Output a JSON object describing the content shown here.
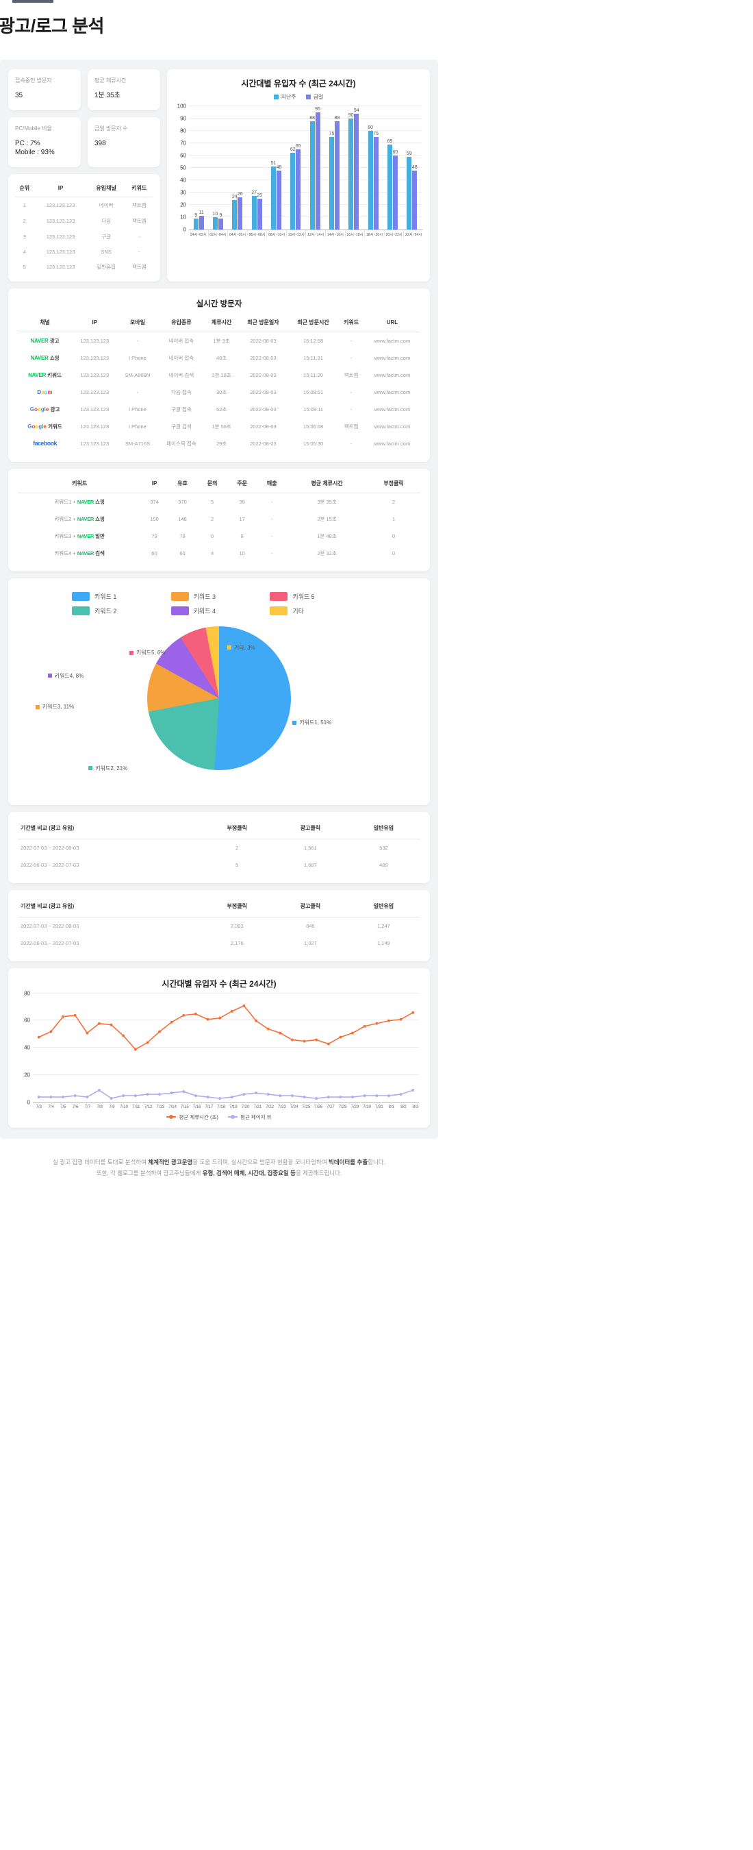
{
  "page": {
    "title": "광고/로그 분석"
  },
  "stats": [
    {
      "label": "접속중인 방문자",
      "value": "35"
    },
    {
      "label": "평균 체류시간",
      "value": "1분 35초"
    },
    {
      "label": "PC/Mobile 비율",
      "value": "PC : 7%\nMobile : 93%"
    },
    {
      "label": "금일 방문자 수",
      "value": "398"
    }
  ],
  "rank_table": {
    "headers": [
      "순위",
      "IP",
      "유입채널",
      "키워드"
    ],
    "rows": [
      [
        "1",
        "123.123.123",
        "네이버",
        "팩트엠"
      ],
      [
        "2",
        "123.123.123",
        "다음",
        "팩트엠"
      ],
      [
        "3",
        "123.123.123",
        "구글",
        "-"
      ],
      [
        "4",
        "123.123.123",
        "SNS",
        "-"
      ],
      [
        "5",
        "123.123.123",
        "일반유입",
        "팩트엠"
      ]
    ]
  },
  "chart_data": [
    {
      "type": "bar",
      "title": "시간대별 유입자 수 (최근 24시간)",
      "legend": [
        "지난주",
        "금일"
      ],
      "colors": [
        "#44aee0",
        "#7b7fe8"
      ],
      "categories": [
        "24시~02시",
        "02시~04시",
        "04시~05시",
        "06시~08시",
        "08시~10시",
        "10시~12시",
        "12시~14시",
        "14시~16시",
        "16시~18시",
        "18시~20시",
        "20시~22시",
        "22시~24시"
      ],
      "series": [
        {
          "name": "지난주",
          "values": [
            9,
            10,
            24,
            27,
            51,
            62,
            88,
            75,
            90,
            80,
            69,
            59
          ]
        },
        {
          "name": "금일",
          "values": [
            11,
            9,
            26,
            25,
            48,
            65,
            95,
            88,
            94,
            75,
            60,
            48
          ]
        }
      ],
      "ylim": [
        0,
        100
      ],
      "yticks": [
        0,
        10,
        20,
        30,
        40,
        50,
        60,
        70,
        80,
        90,
        100
      ],
      "xlabel": "",
      "ylabel": "",
      "grid": true,
      "legend_position": "top"
    },
    {
      "type": "pie",
      "title": "",
      "labels": [
        "키워드 1",
        "키워드 2",
        "키워드 3",
        "키워드 4",
        "키워드 5",
        "기타"
      ],
      "values": [
        51,
        21,
        11,
        8,
        6,
        3
      ],
      "colors": [
        "#3fa9f5",
        "#4cc0ae",
        "#f5a23c",
        "#9b63e8",
        "#f4607c",
        "#fcc63f"
      ],
      "annotations": [
        "키워드1, 51%",
        "키워드2, 21%",
        "키워드3, 11%",
        "키워드4, 8%",
        "키워드5, 6%",
        "기타, 3%"
      ],
      "legend_position": "top"
    },
    {
      "type": "line",
      "title": "시간대별 유입자 수 (최근 24시간)",
      "x": [
        "7/3",
        "7/4",
        "7/5",
        "7/6",
        "7/7",
        "7/8",
        "7/9",
        "7/10",
        "7/11",
        "7/12",
        "7/13",
        "7/14",
        "7/15",
        "7/16",
        "7/17",
        "7/18",
        "7/19",
        "7/20",
        "7/21",
        "7/22",
        "7/23",
        "7/24",
        "7/25",
        "7/26",
        "7/27",
        "7/28",
        "7/29",
        "7/30",
        "7/31",
        "8/1",
        "8/2",
        "8/3"
      ],
      "series": [
        {
          "name": "평균 체류시간 (초)",
          "color": "#f4703a",
          "values": [
            48,
            52,
            63,
            64,
            51,
            58,
            57,
            49,
            39,
            44,
            52,
            59,
            64,
            65,
            61,
            62,
            67,
            71,
            60,
            54,
            51,
            46,
            45,
            46,
            43,
            48,
            51,
            56,
            58,
            60,
            61,
            66
          ]
        },
        {
          "name": "평균 페이지 뷰",
          "color": "#aeadee",
          "values": [
            4,
            4,
            4,
            5,
            4,
            9,
            3,
            5,
            5,
            6,
            6,
            7,
            8,
            5,
            4,
            3,
            4,
            6,
            7,
            6,
            5,
            5,
            4,
            3,
            4,
            4,
            4,
            5,
            5,
            5,
            6,
            9
          ]
        }
      ],
      "ylim": [
        0,
        80
      ],
      "yticks": [
        0,
        20,
        40,
        60,
        80
      ],
      "grid": true,
      "legend_position": "bottom"
    }
  ],
  "realtime": {
    "title": "실시간 방문자",
    "headers": [
      "채널",
      "IP",
      "모바일",
      "유입종류",
      "체류시간",
      "최근 방문일자",
      "최근 방문시간",
      "키워드",
      "URL"
    ],
    "rows": [
      {
        "brand": "naver",
        "suffix": "광고",
        "ip": "123.123.123",
        "mobile": "-",
        "type": "네이버 접속",
        "stay": "1분 3초",
        "date": "2022-08-03",
        "time": "15:12:58",
        "keyword": "-",
        "url": "www.factm.com"
      },
      {
        "brand": "naver",
        "suffix": "쇼핑",
        "ip": "123.123.123",
        "mobile": "I Phone",
        "type": "네이버 접속",
        "stay": "48초",
        "date": "2022-08-03",
        "time": "15:11:31",
        "keyword": "-",
        "url": "www.factm.com"
      },
      {
        "brand": "naver",
        "suffix": "키워드",
        "ip": "123.123.123",
        "mobile": "SM-A908N",
        "type": "네이버 검색",
        "stay": "2분 18초",
        "date": "2022-08-03",
        "time": "15:11:20",
        "keyword": "팩트엠",
        "url": "www.factm.com"
      },
      {
        "brand": "daum",
        "suffix": "",
        "ip": "123.123.123",
        "mobile": "-",
        "type": "다음 접속",
        "stay": "30초",
        "date": "2022-08-03",
        "time": "15:08:51",
        "keyword": "-",
        "url": "www.factm.com"
      },
      {
        "brand": "google",
        "suffix": "광고",
        "ip": "123.123.123",
        "mobile": "I Phone",
        "type": "구글 접속",
        "stay": "52초",
        "date": "2022-08-03",
        "time": "15:08:11",
        "keyword": "-",
        "url": "www.factm.com"
      },
      {
        "brand": "google",
        "suffix": "키워드",
        "ip": "123.123.123",
        "mobile": "I Phone",
        "type": "구글 검색",
        "stay": "1분 56초",
        "date": "2022-08-03",
        "time": "15:06:08",
        "keyword": "팩트엠",
        "url": "www.factm.com"
      },
      {
        "brand": "facebook",
        "suffix": "",
        "ip": "123.123.123",
        "mobile": "SM-A716S",
        "type": "페이스북 접속",
        "stay": "29초",
        "date": "2022-08-03",
        "time": "15:05:30",
        "keyword": "-",
        "url": "www.factm.com"
      }
    ]
  },
  "keyword_table": {
    "headers": [
      "키워드",
      "IP",
      "유효",
      "문의",
      "주문",
      "매출",
      "평균 체류시간",
      "부정클릭"
    ],
    "rows": [
      {
        "pre": "키워드1 +",
        "brand": "NAVER",
        "post": "쇼핑",
        "ip": "374",
        "valid": "370",
        "inquiry": "5",
        "order": "35",
        "sales": "-",
        "stay": "3분 35초",
        "fraud": "2"
      },
      {
        "pre": "키워드2 +",
        "brand": "NAVER",
        "post": "쇼핑",
        "ip": "150",
        "valid": "148",
        "inquiry": "2",
        "order": "17",
        "sales": "-",
        "stay": "2분 15초",
        "fraud": "1"
      },
      {
        "pre": "키워드3 +",
        "brand": "NAVER",
        "post": "일반",
        "ip": "79",
        "valid": "78",
        "inquiry": "0",
        "order": "8",
        "sales": "-",
        "stay": "1분 48초",
        "fraud": "0"
      },
      {
        "pre": "키워드4 +",
        "brand": "NAVER",
        "post": "검색",
        "ip": "60",
        "valid": "60",
        "inquiry": "4",
        "order": "10",
        "sales": "-",
        "stay": "2분 32초",
        "fraud": "0"
      }
    ]
  },
  "compare_1": {
    "headers": [
      "기간별 비교 (광고 유입)",
      "부정클릭",
      "광고클릭",
      "일반유입"
    ],
    "rows": [
      [
        "2022-07-03 ~ 2022-08-03",
        "2",
        "1,561",
        "532"
      ],
      [
        "2022-06-03 ~ 2022-07-03",
        "5",
        "1,687",
        "489"
      ]
    ]
  },
  "compare_2": {
    "headers": [
      "기간별 비교 (광고 유입)",
      "부정클릭",
      "광고클릭",
      "일반유입"
    ],
    "rows": [
      [
        "2022-07-03 ~ 2022-08-03",
        "2,093",
        "846",
        "1,247"
      ],
      [
        "2022-06-03 ~ 2022-07-03",
        "2,176",
        "1,027",
        "1,149"
      ]
    ]
  },
  "footer": {
    "line1_a": "실 광고 집행 데이터를 토대로 분석하여 ",
    "line1_b": "체계적인 광고운영",
    "line1_c": "을 도움 드리며, 실시간으로 방문자 현황을 모니터링하여 ",
    "line1_d": "빅데이터를 추출",
    "line1_e": "합니다.",
    "line2_a": "또한, 각 웹로그를 분석하여 광고주님들에게 ",
    "line2_b": "유형, 검색어 매체, 시간대, 집중요일 등",
    "line2_c": "을 제공해드립니다."
  }
}
